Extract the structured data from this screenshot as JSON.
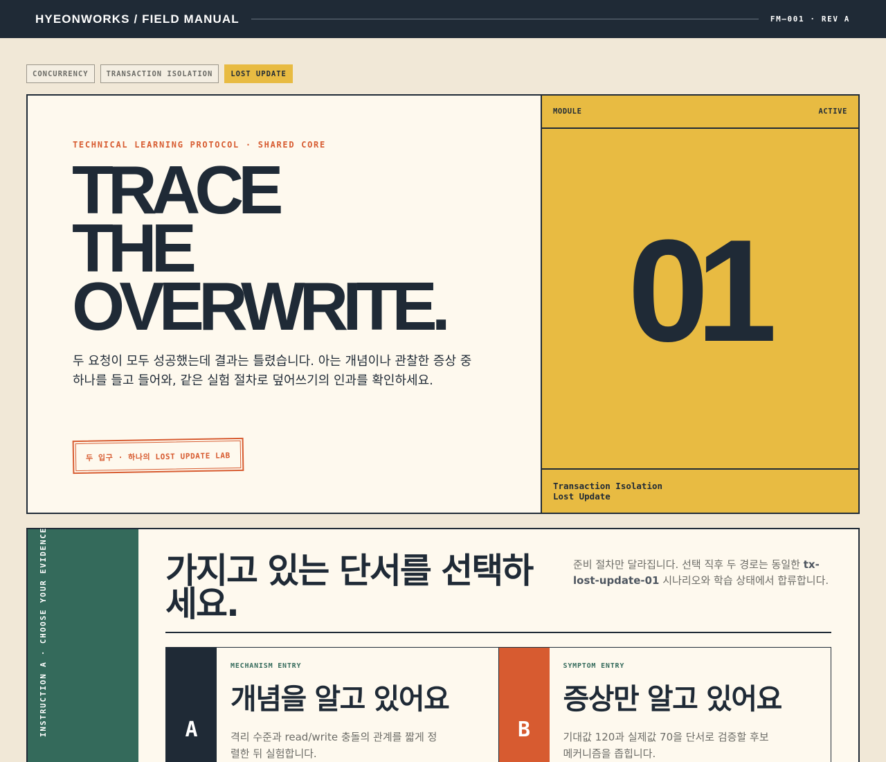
{
  "header": {
    "brand": "HYEONWORKS / FIELD MANUAL",
    "doc_id": "FM–001 · REV A"
  },
  "tags": [
    {
      "label": "CONCURRENCY",
      "active": false
    },
    {
      "label": "TRANSACTION ISOLATION",
      "active": false
    },
    {
      "label": "LOST UPDATE",
      "active": true
    }
  ],
  "hero": {
    "protocol": "TECHNICAL LEARNING PROTOCOL · SHARED CORE",
    "headline": [
      "TRACE",
      "THE",
      "OVERWRITE."
    ],
    "intro": "두 요청이 모두 성공했는데 결과는 틀렸습니다. 아는 개념이나 관찰한 증상 중 하나를 들고 들어와, 같은 실험 절차로 덮어쓰기의 인과를 확인하세요.",
    "stamp": "두 입구 · 하나의 LOST UPDATE LAB"
  },
  "module": {
    "label": "MODULE",
    "status": "ACTIVE",
    "number": "01",
    "foot_line1": "Transaction Isolation",
    "foot_line2": "Lost Update"
  },
  "section": {
    "side_label": "INSTRUCTION A · CHOOSE YOUR EVIDENCE",
    "title": "가지고 있는 단서를 선택하세요.",
    "note_before": "준비 절차만 달라집니다. 선택 직후 두 경로는 동일한 ",
    "note_code": "tx-lost-update-01",
    "note_after": " 시나리오와 학습 상태에서 합류합니다."
  },
  "cards": [
    {
      "badge": "A",
      "kicker": "MECHANISM ENTRY",
      "title": "개념을 알고 있어요",
      "desc": "격리 수준과 read/write 충돌의 관계를 짧게 정렬한 뒤 실험합니다."
    },
    {
      "badge": "B",
      "kicker": "SYMPTOM ENTRY",
      "title": "증상만 알고 있어요",
      "desc": "기대값 120과 실제값 70을 단서로 검증할 후보 메커니즘을 좁힙니다."
    }
  ],
  "colors": {
    "navy": "#1f2a36",
    "cream": "#f1e8d7",
    "paper": "#fef9ee",
    "mustard": "#e8bb42",
    "orange": "#d75b30",
    "green": "#346a5b"
  }
}
